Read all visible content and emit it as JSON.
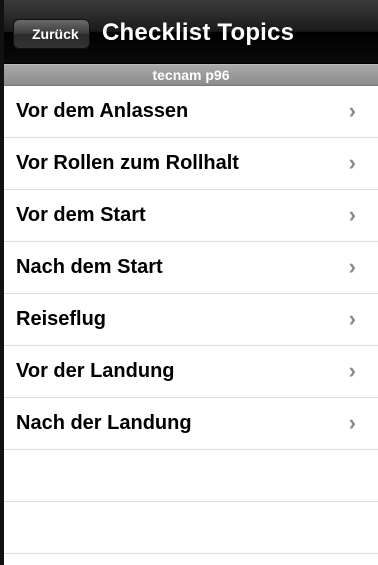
{
  "navbar": {
    "back_label": "Zurück",
    "title": "Checklist Topics"
  },
  "section": {
    "header": "tecnam p96"
  },
  "list": {
    "items": [
      {
        "label": "Vor dem Anlassen",
        "chevron": "›"
      },
      {
        "label": "Vor Rollen zum Rollhalt",
        "chevron": "›"
      },
      {
        "label": "Vor dem Start",
        "chevron": "›"
      },
      {
        "label": "Nach dem Start",
        "chevron": "›"
      },
      {
        "label": "Reiseflug",
        "chevron": "›"
      },
      {
        "label": "Vor der Landung",
        "chevron": "›"
      },
      {
        "label": "Nach der Landung",
        "chevron": "›"
      }
    ]
  },
  "colors": {
    "navbar": "#000000",
    "section_header": "#999999",
    "row_separator": "#dcdcdc",
    "chevron": "#8a8a8a"
  },
  "icons": {
    "chevron": "chevron-right-icon"
  }
}
